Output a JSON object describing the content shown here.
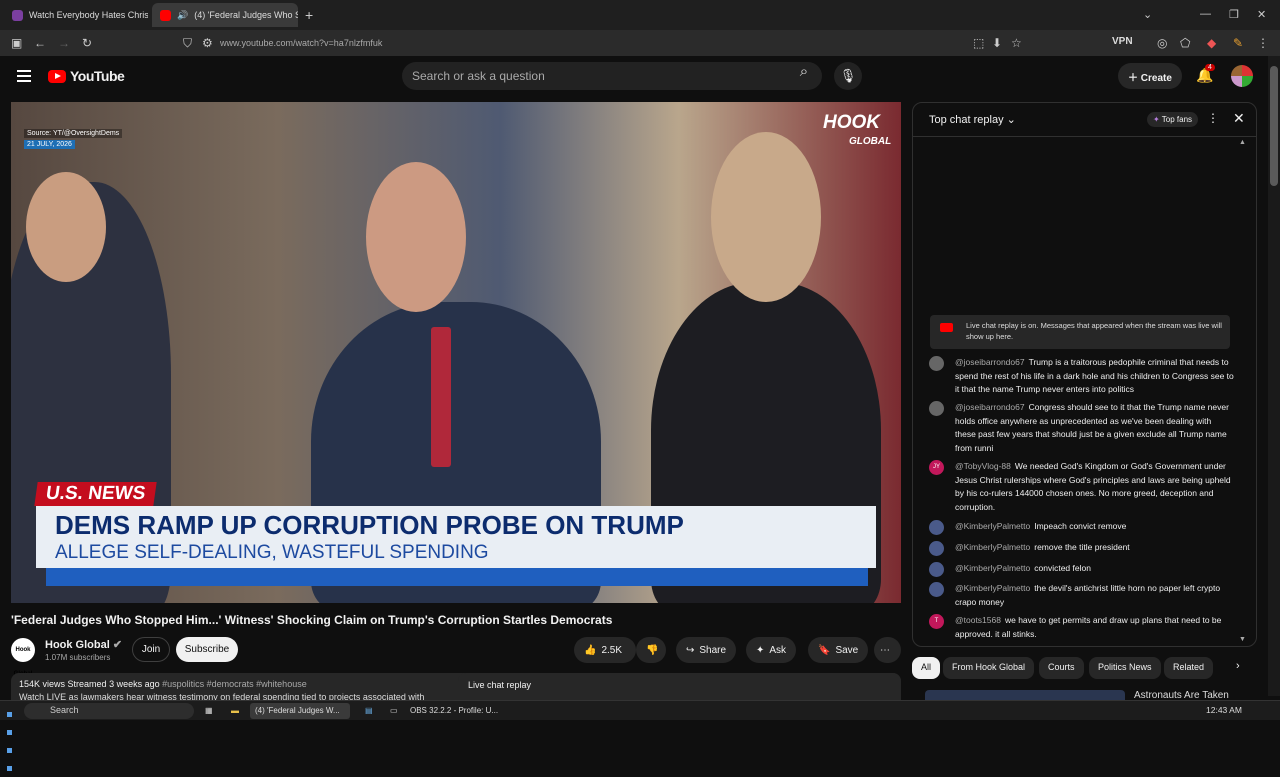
{
  "browser": {
    "tabs": [
      {
        "title": "Watch Everybody Hates Chris S",
        "favicon_color": "#7b3fa0"
      },
      {
        "title": "(4) 'Federal Judges Who St",
        "favicon_color": "#ff0000",
        "active": true
      }
    ],
    "url": "www.youtube.com/watch?v=ha7nlzfmfuk",
    "vpn_label": "VPN",
    "new_tab_icon": "+"
  },
  "youtube": {
    "logo_text": "YouTube",
    "search_placeholder": "Search or ask a question",
    "create_label": "Create",
    "notification_count": "4"
  },
  "video": {
    "source_text": "Source: YT/@OversightDems",
    "source_date": "21 JULY, 2026",
    "watermark": "HOOK",
    "watermark_sub": "GLOBAL",
    "tag": "U.S. NEWS",
    "headline": "DEMS RAMP UP CORRUPTION PROBE ON TRUMP",
    "subheadline": "ALLEGE SELF-DEALING, WASTEFUL SPENDING",
    "title": "'Federal Judges Who Stopped Him...' Witness' Shocking Claim on Trump's Corruption Startles Democrats"
  },
  "channel": {
    "icon_text": "Hook Global",
    "name": "Hook Global",
    "subscribers": "1.07M subscribers",
    "join_label": "Join",
    "subscribe_label": "Subscribe"
  },
  "actions": {
    "likes": "2.5K",
    "share_label": "Share",
    "ask_label": "Ask",
    "save_label": "Save"
  },
  "description": {
    "views": "154K views",
    "streamed": "Streamed 3 weeks ago",
    "hashtags": "#uspolitics #democrats #whitehouse",
    "snippet": "Watch LIVE as lawmakers hear witness testimony on federal spending tied to projects associated with",
    "live_chat_label": "Live chat replay"
  },
  "chat": {
    "title": "Top chat replay",
    "top_fans_label": "Top fans",
    "banner": "Live chat replay is on. Messages that appeared when the stream was live will show up here.",
    "messages": [
      {
        "user": "@joseibarrondo67",
        "text": "Trump is a traitorous pedophile criminal that needs to spend the rest of his life in a dark hole and his children to Congress see to it that the name Trump never enters into politics",
        "avatar_color": "#666666",
        "avatar_text": ""
      },
      {
        "user": "@joseibarrondo67",
        "text": "Congress should see to it that the Trump name never holds office anywhere as unprecedented as we've been dealing with these past few years that should just be a given exclude all Trump name from runni",
        "avatar_color": "#666666",
        "avatar_text": ""
      },
      {
        "user": "@TobyVlog-88",
        "text": "We needed God's Kingdom or God's Government under Jesus Christ rulerships where God's principles and laws are being upheld by his co-rulers 144000 chosen ones. No more greed, deception and corruption.",
        "avatar_color": "#c2185b",
        "avatar_text": "JY"
      },
      {
        "user": "@KimberlyPalmetto",
        "text": "Impeach convict remove",
        "avatar_color": "#4a5a8a",
        "avatar_text": ""
      },
      {
        "user": "@KimberlyPalmetto",
        "text": "remove the title president",
        "avatar_color": "#4a5a8a",
        "avatar_text": ""
      },
      {
        "user": "@KimberlyPalmetto",
        "text": "convicted felon",
        "avatar_color": "#4a5a8a",
        "avatar_text": ""
      },
      {
        "user": "@KimberlyPalmetto",
        "text": "the devil's antichrist little horn no paper left crypto crapo money",
        "avatar_color": "#4a5a8a",
        "avatar_text": ""
      },
      {
        "user": "@toots1568",
        "text": "we have to get permits and draw up plans that need to be approved. it all stinks.",
        "avatar_color": "#c2185b",
        "avatar_text": "T"
      }
    ]
  },
  "chips": [
    "All",
    "From Hook Global",
    "Courts",
    "Politics News",
    "Related"
  ],
  "up_next_title": "Astronauts Are Taken",
  "taskbar": {
    "search_label": "Search",
    "chrome_label": "(4) 'Federal Judges W...",
    "obs_label": "OBS 32.2.2 - Profile: U...",
    "clock": "12:43 AM"
  }
}
